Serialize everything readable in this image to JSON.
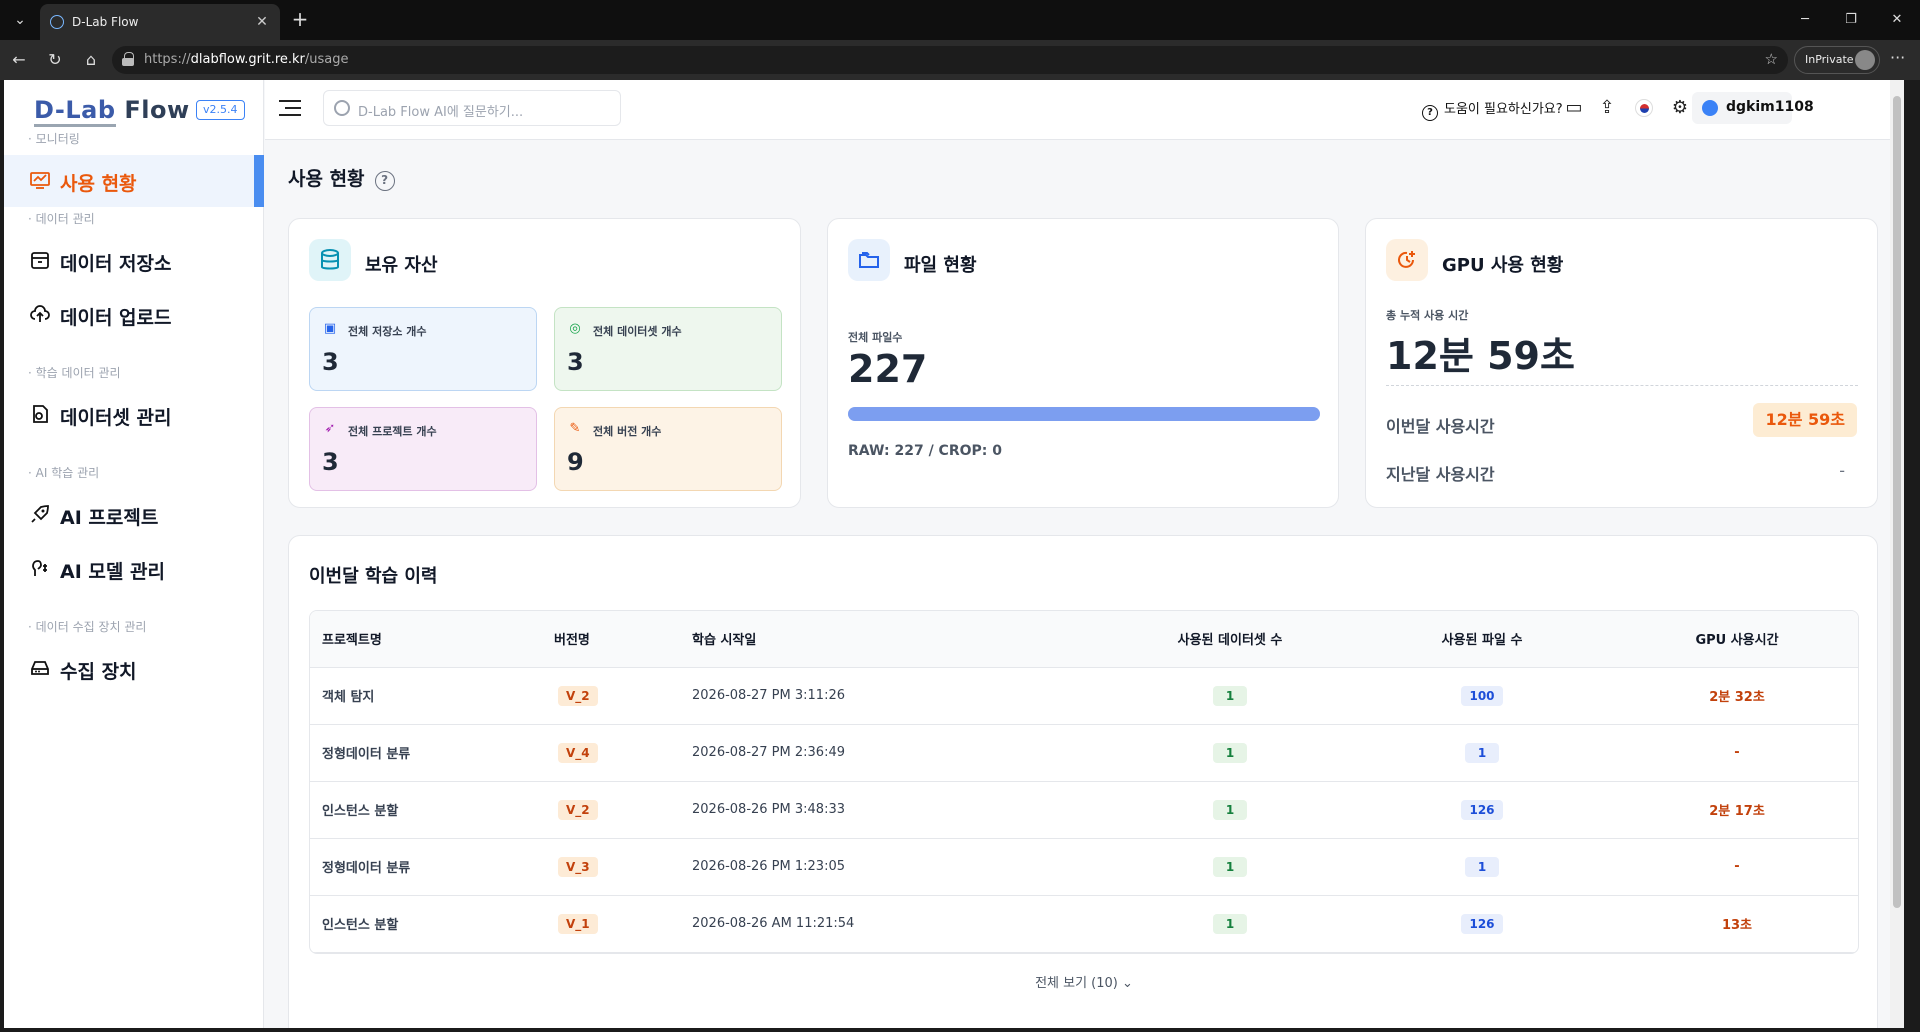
{
  "browser": {
    "tab_title": "D-Lab Flow",
    "url_host": "dlabflow.grit.re.kr",
    "url_path": "/usage",
    "url_prefix": "https://",
    "inprivate": "InPrivate"
  },
  "app": {
    "logo": "D-Lab Flow",
    "version": "v2.5.4"
  },
  "sidebar": {
    "sections": [
      {
        "label": "· 모니터링",
        "items": [
          {
            "label": "사용 현황",
            "icon": "monitor-chart-icon",
            "active": true
          }
        ]
      },
      {
        "label": "· 데이터 관리",
        "items": [
          {
            "label": "데이터 저장소",
            "icon": "archive-box-icon"
          },
          {
            "label": "데이터 업로드",
            "icon": "cloud-upload-icon"
          }
        ]
      },
      {
        "label": "· 학습 데이터 관리",
        "items": [
          {
            "label": "데이터셋 관리",
            "icon": "dataset-icon"
          }
        ]
      },
      {
        "label": "· AI 학습 관리",
        "items": [
          {
            "label": "AI 프로젝트",
            "icon": "rocket-icon"
          },
          {
            "label": "AI 모델 관리",
            "icon": "brain-icon"
          }
        ]
      },
      {
        "label": "· 데이터 수집 장치 관리",
        "items": [
          {
            "label": "수집 장치",
            "icon": "device-icon"
          }
        ]
      }
    ]
  },
  "topbar": {
    "ai_placeholder": "D-Lab Flow AI에 질문하기...",
    "help": "도움이 필요하신가요?",
    "username": "dgkim1108"
  },
  "page": {
    "title": "사용 현황"
  },
  "assets": {
    "title": "보유 자산",
    "stats": [
      {
        "label": "전체 저장소 개수",
        "value": "3",
        "icon": "archive-box-icon",
        "bg": "#eef5fd",
        "border": "#bcd6f3",
        "color": "#2563eb"
      },
      {
        "label": "전체 데이터셋 개수",
        "value": "3",
        "icon": "dataset-icon",
        "bg": "#eef7ee",
        "border": "#c4e3c4",
        "color": "#16a34a"
      },
      {
        "label": "전체 프로젝트 개수",
        "value": "3",
        "icon": "rocket-icon",
        "bg": "#f8ebf8",
        "border": "#e3c0e6",
        "color": "#a21caf"
      },
      {
        "label": "전체 버전 개수",
        "value": "9",
        "icon": "brain-icon",
        "bg": "#fdf3e6",
        "border": "#f3d7b2",
        "color": "#ea580c"
      }
    ]
  },
  "files": {
    "title": "파일 현황",
    "total_label": "전체 파일수",
    "total": "227",
    "progress": 1.0,
    "breakdown": "RAW: 227 / CROP: 0"
  },
  "gpu": {
    "title": "GPU 사용 현황",
    "total_label": "총 누적 사용 시간",
    "total": "12분 59초",
    "this_month_label": "이번달 사용시간",
    "this_month": "12분 59초",
    "last_month_label": "지난달 사용시간",
    "last_month": "-"
  },
  "history": {
    "title": "이번달 학습 이력",
    "columns": [
      "프로젝트명",
      "버전명",
      "학습 시작일",
      "사용된 데이터셋 수",
      "사용된 파일 수",
      "GPU 사용시간"
    ],
    "rows": [
      {
        "project": "객체 탐지",
        "version": "V_2",
        "start": "2026-08-27 PM 3:11:26",
        "datasets": "1",
        "files": "100",
        "gpu": "2분 32초"
      },
      {
        "project": "정형데이터 분류",
        "version": "V_4",
        "start": "2026-08-27 PM 2:36:49",
        "datasets": "1",
        "files": "1",
        "gpu": "-"
      },
      {
        "project": "인스턴스 분할",
        "version": "V_2",
        "start": "2026-08-26 PM 3:48:33",
        "datasets": "1",
        "files": "126",
        "gpu": "2분 17초"
      },
      {
        "project": "정형데이터 분류",
        "version": "V_3",
        "start": "2026-08-26 PM 1:23:05",
        "datasets": "1",
        "files": "1",
        "gpu": "-"
      },
      {
        "project": "인스턴스 분할",
        "version": "V_1",
        "start": "2026-08-26 AM 11:21:54",
        "datasets": "1",
        "files": "126",
        "gpu": "13초"
      }
    ],
    "view_all": "전체 보기 (10)"
  }
}
